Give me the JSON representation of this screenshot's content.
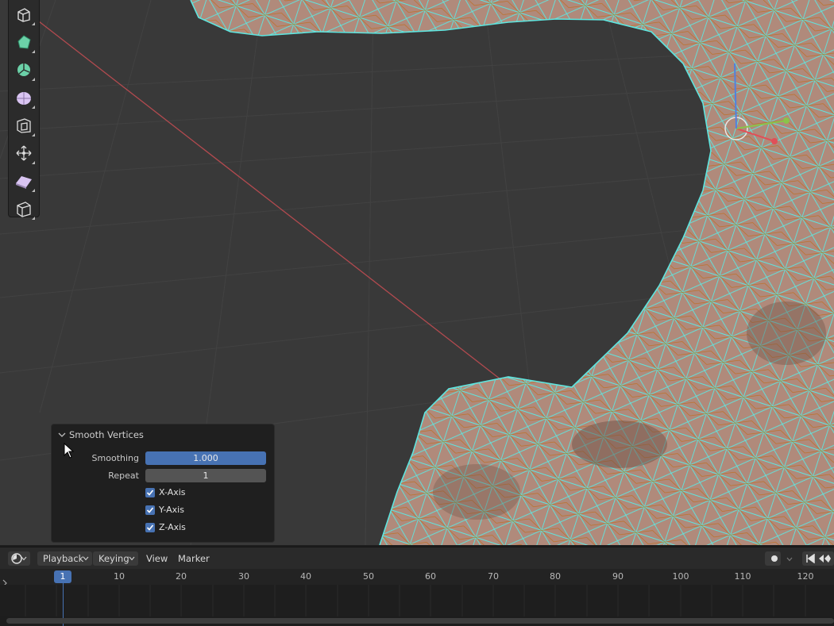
{
  "viewport": {
    "origin_axis_color": "#b24a4f",
    "wire_color": "#5ee6e0",
    "mesh_color": "#c8957a"
  },
  "toolbar": {
    "tools": [
      {
        "name": "extrude-region-icon",
        "color": "#dcdcdc"
      },
      {
        "name": "poly-build-icon",
        "color": "#6bd1a8"
      },
      {
        "name": "spin-icon",
        "color": "#6bd1a8"
      },
      {
        "name": "smooth-icon",
        "color": "#d9c4f2"
      },
      {
        "name": "inset-icon",
        "color": "#dcdcdc"
      },
      {
        "name": "shrink-fatten-icon",
        "color": "#dcdcdc"
      },
      {
        "name": "shear-icon",
        "color": "#d9c4f2"
      },
      {
        "name": "rip-region-icon",
        "color": "#dcdcdc"
      }
    ]
  },
  "operator_panel": {
    "title": "Smooth Vertices",
    "smoothing_label": "Smoothing",
    "smoothing_value": "1.000",
    "repeat_label": "Repeat",
    "repeat_value": "1",
    "x_axis_label": "X-Axis",
    "y_axis_label": "Y-Axis",
    "z_axis_label": "Z-Axis",
    "x_axis_checked": true,
    "y_axis_checked": true,
    "z_axis_checked": true
  },
  "timeline": {
    "editor_icon": "clock-icon",
    "playback_label": "Playback",
    "keying_label": "Keying",
    "view_label": "View",
    "marker_label": "Marker",
    "current_frame": "1",
    "frame_ticks": [
      "10",
      "20",
      "30",
      "40",
      "50",
      "60",
      "70",
      "80",
      "90",
      "100",
      "110",
      "120"
    ]
  }
}
